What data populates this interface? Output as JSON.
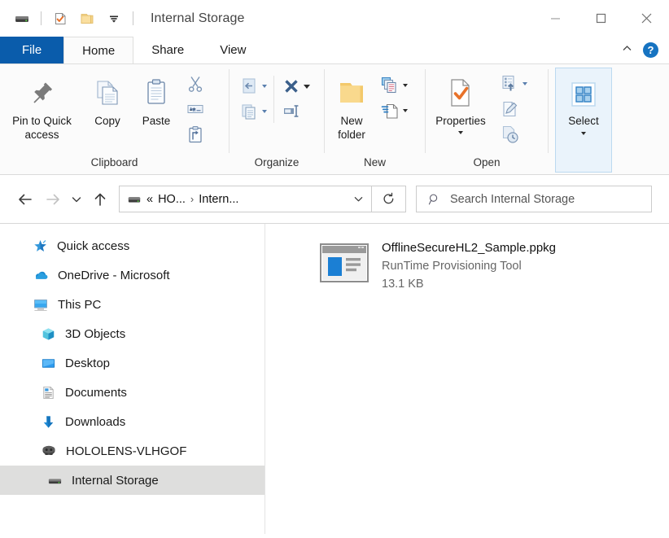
{
  "window": {
    "title": "Internal Storage",
    "quick_access": [
      {
        "name": "drive-icon",
        "label": "Internal Storage"
      },
      {
        "name": "properties-icon",
        "label": "Properties"
      },
      {
        "name": "new-folder-icon",
        "label": "New folder"
      },
      {
        "name": "customize-qat-icon",
        "label": "Customize Quick Access Toolbar"
      }
    ],
    "controls": {
      "minimize": "Minimize",
      "maximize": "Maximize",
      "close": "Close"
    }
  },
  "tabs": [
    {
      "label": "File",
      "id": "file"
    },
    {
      "label": "Home",
      "id": "home"
    },
    {
      "label": "Share",
      "id": "share"
    },
    {
      "label": "View",
      "id": "view"
    }
  ],
  "tab_right": {
    "collapse_label": "Minimize the Ribbon",
    "help_label": "?"
  },
  "ribbon": {
    "groups": [
      {
        "label": "Clipboard",
        "big": [
          {
            "label": "Pin to Quick\naccess",
            "line1": "Pin to Quick",
            "line2": "access",
            "icon": "pin-icon"
          },
          {
            "label": "Copy",
            "icon": "copy-icon"
          },
          {
            "label": "Paste",
            "icon": "paste-icon"
          }
        ],
        "small": [
          {
            "label": "Cut",
            "icon": "cut-icon"
          },
          {
            "label": "Copy path",
            "icon": "copy-path-icon"
          },
          {
            "label": "Paste shortcut",
            "icon": "paste-shortcut-icon"
          }
        ]
      },
      {
        "label": "Organize",
        "small": [
          {
            "label": "Move to",
            "icon": "move-to-icon",
            "dropdown": true,
            "disabled": true
          },
          {
            "label": "Copy to",
            "icon": "copy-to-icon",
            "dropdown": true,
            "disabled": true
          },
          {
            "label": "Delete",
            "icon": "delete-icon",
            "dropdown": true
          },
          {
            "label": "Rename",
            "icon": "rename-icon"
          }
        ]
      },
      {
        "label": "New",
        "big": [
          {
            "label": "New\nfolder",
            "line1": "New",
            "line2": "folder",
            "icon": "new-folder-icon"
          }
        ],
        "small": [
          {
            "label": "New item",
            "icon": "new-item-icon",
            "dropdown": true
          },
          {
            "label": "Easy access",
            "icon": "easy-access-icon",
            "dropdown": true
          }
        ]
      },
      {
        "label": "Open",
        "big": [
          {
            "label": "Properties",
            "line1": "Properties",
            "icon": "properties-icon",
            "dropdown": true
          }
        ],
        "small": [
          {
            "label": "Open",
            "icon": "open-icon",
            "dropdown": true,
            "disabled": true
          },
          {
            "label": "Edit",
            "icon": "edit-icon",
            "disabled": true
          },
          {
            "label": "History",
            "icon": "history-icon",
            "disabled": true
          }
        ]
      },
      {
        "label": "",
        "highlighted": true,
        "big": [
          {
            "label": "Select",
            "line1": "Select",
            "icon": "select-icon",
            "dropdown": true
          }
        ]
      }
    ]
  },
  "navigation": {
    "back": "Back",
    "forward": "Forward",
    "recent": "Recent locations",
    "up": "Up",
    "breadcrumb": {
      "icon": "drive-icon",
      "overflow": "«",
      "segments": [
        "HO...",
        "Intern..."
      ],
      "separator": "›"
    },
    "dropdown_label": "Previous Locations",
    "refresh_label": "Refresh"
  },
  "search": {
    "icon": "search-icon",
    "placeholder": "Search Internal Storage",
    "value": ""
  },
  "sidebar": {
    "items": [
      {
        "label": "Quick access",
        "icon": "star-pin-icon",
        "indent": 0,
        "selected": false
      },
      {
        "label": "OneDrive - Microsoft",
        "icon": "onedrive-cloud-icon",
        "indent": 0,
        "selected": false
      },
      {
        "label": "This PC",
        "icon": "monitor-icon",
        "indent": 0,
        "selected": false
      },
      {
        "label": "3D Objects",
        "icon": "cube-icon",
        "indent": 1,
        "selected": false
      },
      {
        "label": "Desktop",
        "icon": "desktop-icon",
        "indent": 1,
        "selected": false
      },
      {
        "label": "Documents",
        "icon": "documents-icon",
        "indent": 1,
        "selected": false
      },
      {
        "label": "Downloads",
        "icon": "downloads-arrow-icon",
        "indent": 1,
        "selected": false
      },
      {
        "label": "HOLOLENS-VLHGOF",
        "icon": "hololens-icon",
        "indent": 1,
        "selected": false
      },
      {
        "label": "Internal Storage",
        "icon": "drive-icon",
        "indent": 2,
        "selected": true
      }
    ]
  },
  "content": {
    "files": [
      {
        "name": "OfflineSecureHL2_Sample.ppkg",
        "type": "RunTime Provisioning Tool",
        "size": "13.1 KB",
        "icon": "ppkg-file-icon"
      }
    ]
  },
  "colors": {
    "accent": "#0a5cab",
    "file_tab": "#0a5cab",
    "selection": "#dededd",
    "highlight": "#eaf3fb",
    "folder_yellow": "#f7d385",
    "blue_icon": "#1b7fd4",
    "check_orange": "#e8722a"
  }
}
